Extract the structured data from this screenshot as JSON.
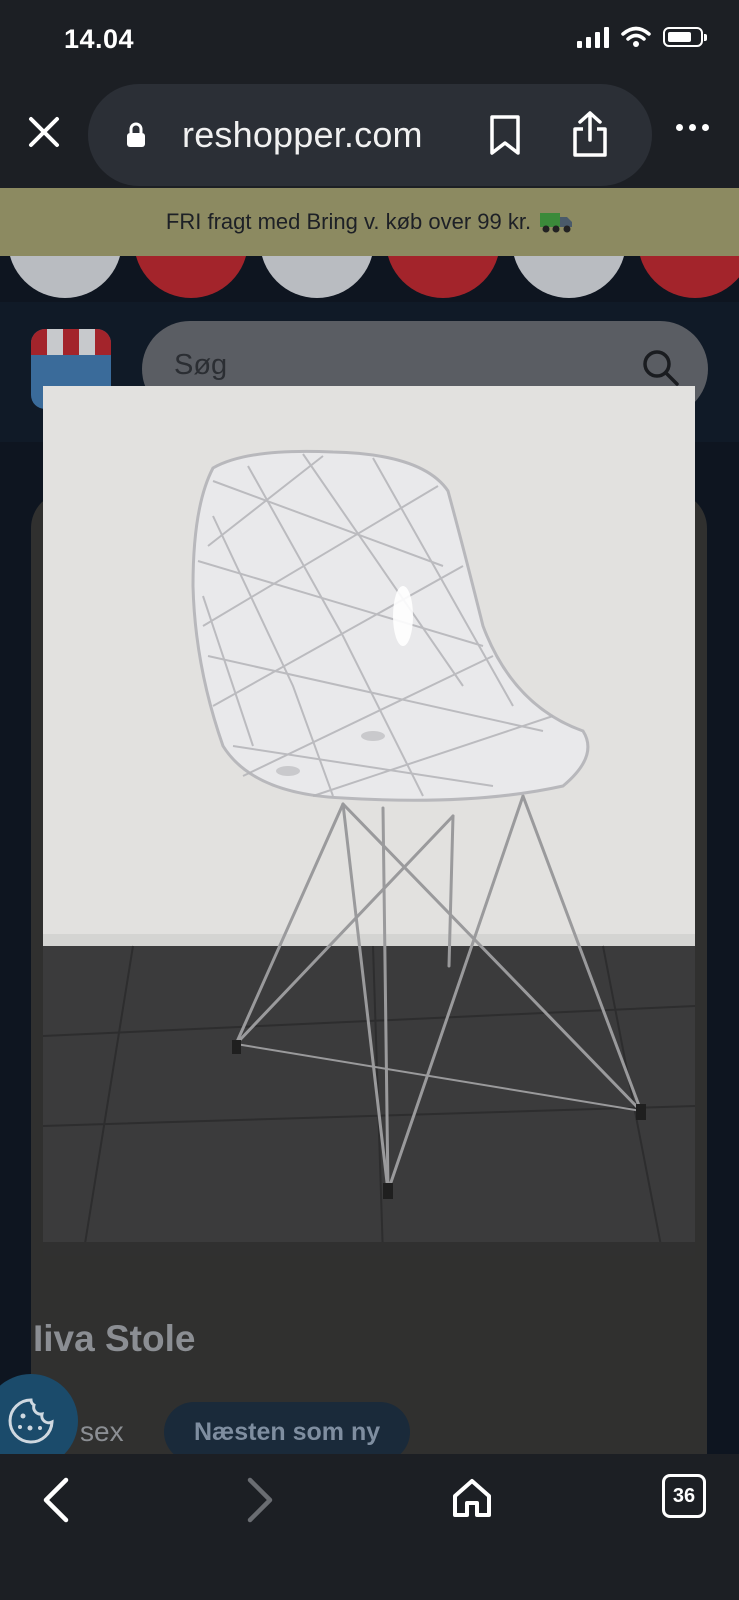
{
  "status_bar": {
    "time": "14.04",
    "battery_level": 0.75
  },
  "browser": {
    "url": "reshopper.com"
  },
  "promo": {
    "text": "FRI fragt med Bring v. køb over 99 kr."
  },
  "search": {
    "placeholder": "Søg"
  },
  "product": {
    "title": "Iiva Stole",
    "gender_partial": "sex",
    "condition": "Næsten som ny"
  },
  "toolbar": {
    "tab_count": "36"
  },
  "colors": {
    "promo_bg": "#8c8a61",
    "awning_red": "#a3242b",
    "awning_white": "#b9bcc1",
    "logo_blue": "#3a6b9a"
  }
}
